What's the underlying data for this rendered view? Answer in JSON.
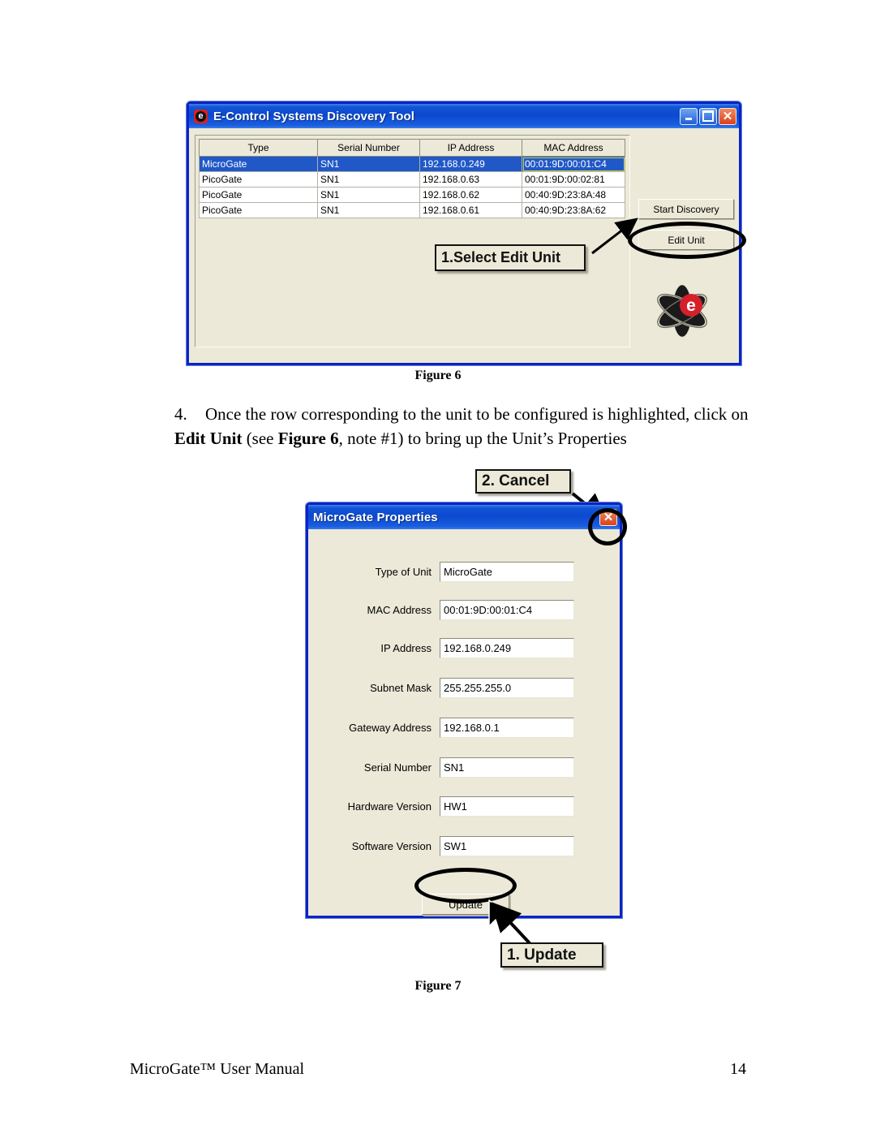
{
  "document": {
    "footer_title": "MicroGate™ User Manual",
    "page_number": "14"
  },
  "figure6": {
    "caption": "Figure 6",
    "window": {
      "title": "E-Control Systems Discovery Tool",
      "app_icon": "e",
      "minimize_label": "Minimize",
      "maximize_label": "Maximize",
      "close_label": "Close"
    },
    "table": {
      "columns": [
        "Type",
        "Serial Number",
        "IP Address",
        "MAC Address"
      ],
      "rows": [
        {
          "type": "MicroGate",
          "serial": "SN1",
          "ip": "192.168.0.249",
          "mac": "00:01:9D:00:01:C4",
          "selected": true
        },
        {
          "type": "PicoGate",
          "serial": "SN1",
          "ip": "192.168.0.63",
          "mac": "00:01:9D:00:02:81",
          "selected": false
        },
        {
          "type": "PicoGate",
          "serial": "SN1",
          "ip": "192.168.0.62",
          "mac": "00:40:9D:23:8A:48",
          "selected": false
        },
        {
          "type": "PicoGate",
          "serial": "SN1",
          "ip": "192.168.0.61",
          "mac": "00:40:9D:23:8A:62",
          "selected": false
        }
      ]
    },
    "buttons": {
      "start_discovery": "Start Discovery",
      "edit_unit": "Edit Unit"
    },
    "logo": {
      "letter": "e",
      "accent_color": "#d5202b"
    },
    "callout": "1.Select Edit Unit"
  },
  "instruction": {
    "number": "4.",
    "part1": "Once the row corresponding to the unit to be configured is highlighted, click on ",
    "bold1": "Edit Unit",
    "part2": " (see ",
    "bold2": "Figure 6",
    "part3": ", note #1) to bring up the Unit’s Properties"
  },
  "figure7": {
    "caption": "Figure 7",
    "window": {
      "title": "MicroGate Properties",
      "close_label": "Close"
    },
    "fields": [
      {
        "label": "Type of Unit",
        "value": "MicroGate"
      },
      {
        "label": "MAC Address",
        "value": "00:01:9D:00:01:C4"
      },
      {
        "label": "IP Address",
        "value": "192.168.0.249"
      },
      {
        "label": "Subnet Mask",
        "value": "255.255.255.0"
      },
      {
        "label": "Gateway Address",
        "value": "192.168.0.1"
      },
      {
        "label": "Serial Number",
        "value": "SN1"
      },
      {
        "label": "Hardware Version",
        "value": "HW1"
      },
      {
        "label": "Software Version",
        "value": "SW1"
      }
    ],
    "buttons": {
      "update": "Update"
    },
    "callout_cancel": "2. Cancel",
    "callout_update": "1. Update"
  },
  "colors": {
    "titlebar_blue": "#0b49cf",
    "window_border": "#0a24c8",
    "face": "#ece9d8",
    "selection": "#2158c8",
    "focus_outline": "#c8d23c",
    "close_red": "#d8431a",
    "logo_red": "#d5202b"
  }
}
